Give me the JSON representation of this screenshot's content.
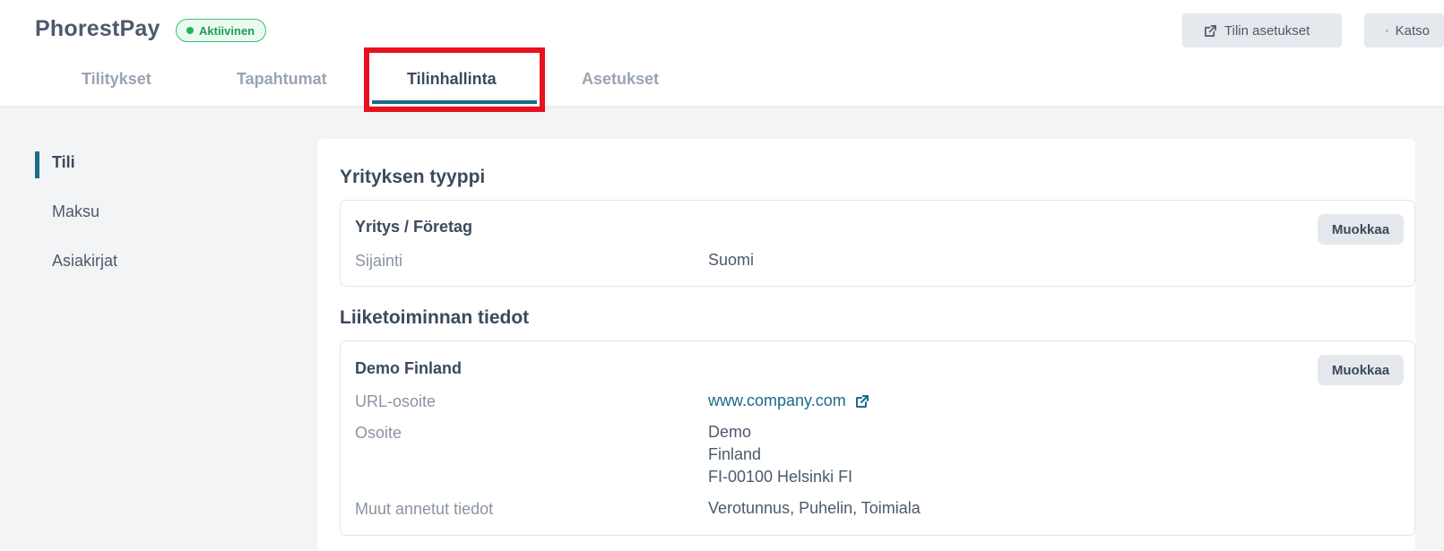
{
  "header": {
    "brand": "PhorestPay",
    "status_badge": "Aktiivinen",
    "account_settings_button": "Tilin asetukset",
    "view_button": "Katso",
    "colors": {
      "accent": "#1b6b8a",
      "status_green": "#22b455",
      "highlight_red": "#e8121f"
    }
  },
  "tabs": [
    {
      "label": "Tilitykset"
    },
    {
      "label": "Tapahtumat"
    },
    {
      "label": "Tilinhallinta",
      "active": true
    },
    {
      "label": "Asetukset"
    }
  ],
  "sidebar": {
    "items": [
      {
        "label": "Tili",
        "active": true
      },
      {
        "label": "Maksu"
      },
      {
        "label": "Asiakirjat"
      }
    ]
  },
  "company_type": {
    "section_title": "Yrityksen tyyppi",
    "card_title": "Yritys / Företag",
    "edit_label": "Muokkaa",
    "location_label": "Sijainti",
    "location_value": "Suomi"
  },
  "business_info": {
    "section_title": "Liiketoiminnan tiedot",
    "card_title": "Demo Finland",
    "edit_label": "Muokkaa",
    "url_label": "URL-osoite",
    "url_value": "www.company.com",
    "address_label": "Osoite",
    "address_lines": [
      "Demo",
      "Finland",
      "FI-00100 Helsinki FI"
    ],
    "other_label": "Muut annetut tiedot",
    "other_value": "Verotunnus, Puhelin, Toimiala"
  },
  "icons": {
    "external_link": "external-link-icon",
    "status_dot": "status-dot-icon"
  }
}
